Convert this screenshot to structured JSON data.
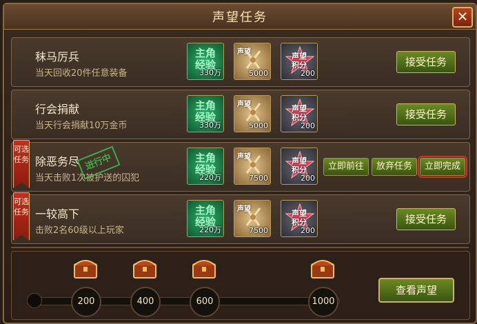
{
  "dialog": {
    "title": "声望任务",
    "close_label": "✕"
  },
  "tasks": [
    {
      "name": "秣马厉兵",
      "desc": "当天回收20件任意装备",
      "exp_label": "主角经验",
      "exp_value": "330万",
      "prestige_tag": "声望",
      "prestige_value": "5000",
      "score_label_1": "声望",
      "score_label_2": "积分",
      "score_value": "200",
      "button": "接受任务"
    },
    {
      "name": "行会捐献",
      "desc": "当天行会捐献10万金币",
      "exp_label": "主角经验",
      "exp_value": "330万",
      "prestige_tag": "声望",
      "prestige_value": "5000",
      "score_label_1": "声望",
      "score_label_2": "积分",
      "score_value": "200",
      "button": "接受任务"
    },
    {
      "name": "除恶务尽",
      "desc": "当天击败1次被护送的囚犯",
      "ribbon": "可选任务",
      "stamp": "进行中",
      "exp_label": "主角经验",
      "exp_value": "220万",
      "prestige_tag": "声望",
      "prestige_value": "7500",
      "score_label_1": "声望",
      "score_label_2": "积分",
      "score_value": "200",
      "buttons": [
        "立即前往",
        "放弃任务",
        "立即完成"
      ]
    },
    {
      "name": "一较高下",
      "desc": "击败2名60级以上玩家",
      "ribbon": "可选任务",
      "exp_label": "主角经验",
      "exp_value": "220万",
      "prestige_tag": "声望",
      "prestige_value": "7500",
      "score_label_1": "声望",
      "score_label_2": "积分",
      "score_value": "200",
      "button": "接受任务"
    }
  ],
  "progress": {
    "milestones": [
      "200",
      "400",
      "600",
      "1000"
    ],
    "view_button": "查看声望"
  },
  "colors": {
    "accent_gold": "#d0b36a",
    "button_green": "#5a7a1a",
    "highlight_red": "#e02a1a"
  }
}
